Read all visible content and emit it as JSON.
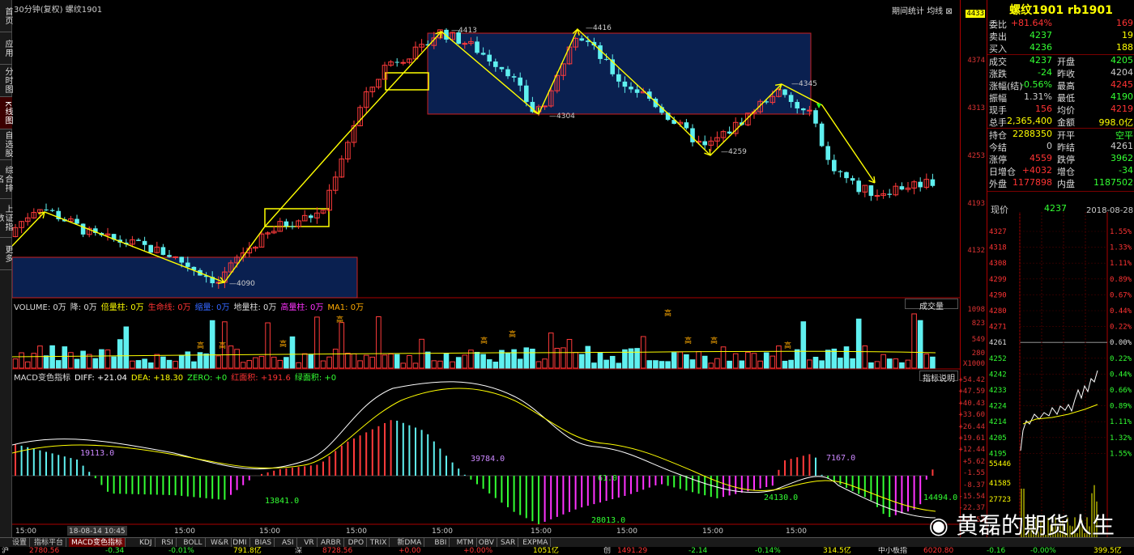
{
  "left_tabs": [
    "首页",
    "应用",
    "分时图",
    "K线图",
    "自选股",
    "综合排名",
    "上证指数",
    "更多"
  ],
  "chart_header": {
    "period": "30分钟(复权)",
    "name": "螺纹1901",
    "btn_stats": "期间统计",
    "btn_ma": "均线"
  },
  "price_axis": [
    "4433",
    "4374",
    "4313",
    "4253",
    "4193",
    "4132"
  ],
  "price_annotations": {
    "high1": "4413",
    "high2": "4416",
    "low1": "4304",
    "low2": "4259",
    "high3": "4345",
    "low0": "4090"
  },
  "vol_header": [
    "VOLUME: 0万",
    "降: 0万",
    "倍量柱: 0万",
    "生命线: 0万",
    "缩量: 0万",
    "地量柱: 0万",
    "高量柱: 0万",
    "MA1: 0万"
  ],
  "vol_axis": [
    "1098",
    "823",
    "549",
    "280",
    "X1000"
  ],
  "vol_btn": "成交量",
  "vol_mark": "高",
  "macd_header": [
    "MACD变色指标",
    "DIFF: +21.04",
    "DEA: +18.30",
    "ZERO: +0",
    "红面积: +191.6",
    "绿面积: +0"
  ],
  "macd_btn": "指标说明",
  "macd_axis": [
    "+54.42",
    "+47.59",
    "+40.43",
    "+33.60",
    "+26.44",
    "+19.61",
    "+12.44",
    "+5.62",
    "-1.55",
    "-8.37",
    "-15.54",
    "-22.37",
    "-29.53"
  ],
  "macd_labels": [
    "19113.0",
    "13841.0",
    "39784.0",
    "61.0",
    "28013.0",
    "7167.0",
    "24130.0",
    "14494.0"
  ],
  "time_axis": [
    "15:00",
    "18-08-14 10:45",
    "15:00",
    "15:00",
    "15:00",
    "15:00",
    "15:00",
    "15:00",
    "15:00",
    "15:00"
  ],
  "quote": {
    "title": "螺纹1901 rb1901",
    "rows": [
      {
        "l": "委比",
        "v": "+81.64%",
        "vc": "#f33",
        "r": "",
        "rv": "169",
        "rvc": "#f33"
      },
      {
        "l": "卖出",
        "v": "4237",
        "vc": "#3f3",
        "r": "",
        "rv": "19",
        "rvc": "#ff0"
      },
      {
        "l": "买入",
        "v": "4236",
        "vc": "#3f3",
        "r": "",
        "rv": "188",
        "rvc": "#ff0"
      },
      {
        "l": "成交",
        "v": "4237",
        "vc": "#3f3",
        "r": "开盘",
        "rv": "4205",
        "rvc": "#3f3"
      },
      {
        "l": "涨跌",
        "v": "-24",
        "vc": "#3f3",
        "r": "昨收",
        "rv": "4204",
        "rvc": "#ccc"
      },
      {
        "l": "涨幅(结)",
        "v": "-0.56%",
        "vc": "#3f3",
        "r": "最高",
        "rv": "4245",
        "rvc": "#f33"
      },
      {
        "l": "振幅",
        "v": "1.31%",
        "vc": "#ccc",
        "r": "最低",
        "rv": "4190",
        "rvc": "#3f3"
      },
      {
        "l": "现手",
        "v": "156",
        "vc": "#f33",
        "r": "均价",
        "rv": "4219",
        "rvc": "#f33"
      },
      {
        "l": "总手",
        "v": "2,365,400",
        "vc": "#ff0",
        "r": "金额",
        "rv": "998.0亿",
        "rvc": "#ff0"
      },
      {
        "l": "持仓",
        "v": "2288350",
        "vc": "#ff0",
        "r": "开平",
        "rv": "空平",
        "rvc": "#3f3"
      },
      {
        "l": "今结",
        "v": "0",
        "vc": "#ccc",
        "r": "昨结",
        "rv": "4261",
        "rvc": "#ccc"
      },
      {
        "l": "涨停",
        "v": "4559",
        "vc": "#f33",
        "r": "跌停",
        "rv": "3962",
        "rvc": "#3f3"
      },
      {
        "l": "日增仓",
        "v": "+4032",
        "vc": "#f33",
        "r": "增仓",
        "rv": "-34",
        "rvc": "#3f3"
      },
      {
        "l": "外盘",
        "v": "1177898",
        "vc": "#f33",
        "r": "内盘",
        "rv": "1187502",
        "rvc": "#3f3"
      }
    ],
    "now_label": "现价",
    "now_value": "4237",
    "now_date": "2018-08-28,二",
    "mini_left_axis": [
      "4327",
      "4318",
      "4308",
      "4299",
      "4290",
      "4280",
      "4271",
      "4261",
      "4252",
      "4242",
      "4233",
      "4224",
      "4214",
      "4205",
      "4195"
    ],
    "mini_right_axis": [
      "1.55%",
      "1.33%",
      "1.11%",
      "0.89%",
      "0.67%",
      "0.44%",
      "0.22%",
      "0.00%",
      "0.22%",
      "0.44%",
      "0.66%",
      "0.89%",
      "1.11%",
      "1.32%",
      "1.55%"
    ],
    "mini_vol_axis": [
      "55446",
      "41585",
      "27723"
    ]
  },
  "bottom_tabs": [
    "设置",
    "指标平台",
    "MACD变色指标",
    "KDJ",
    "RSI",
    "BOLL",
    "W&R",
    "DMI",
    "BIAS",
    "ASI",
    "VR",
    "ARBR",
    "DPO",
    "TRIX",
    "新DMA",
    "BBI",
    "MTM",
    "OBV",
    "SAR",
    "EXPMA"
  ],
  "status": [
    "沪",
    "2780.56",
    "-0.34",
    "-0.01%",
    "791.8亿",
    "深",
    "8728.56",
    "+0.00",
    "+0.00%",
    "1051亿",
    "创",
    "1491.29",
    "-2.14",
    "-0.14%",
    "314.5亿",
    "中小板指",
    "6020.80",
    "-0.16",
    "-0.00%",
    "399.5亿"
  ],
  "watermark": "黄磊的期货人生",
  "colors": {
    "up": "#ff3b3b",
    "down": "#5ff0f0",
    "trend": "#ffff00",
    "box_fill": "#0a2050",
    "box_border": "#cc2020",
    "axis": "#cc2020"
  }
}
